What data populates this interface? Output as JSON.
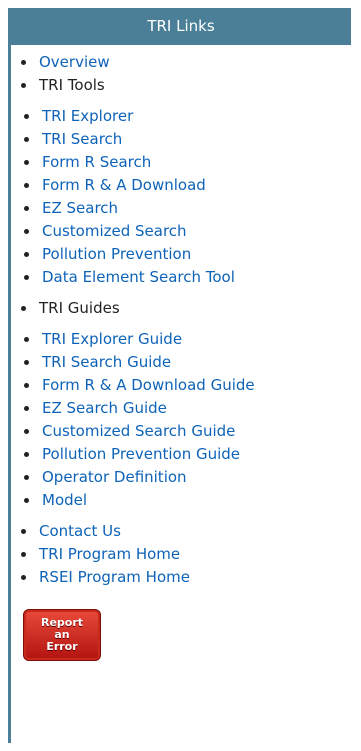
{
  "header": {
    "title": "TRI Links"
  },
  "links": {
    "overview": "Overview",
    "tri_tools": {
      "label": "TRI Tools",
      "items": [
        "TRI Explorer",
        "TRI Search",
        "Form R Search",
        "Form R & A Download",
        "EZ Search",
        "Customized Search",
        "Pollution Prevention",
        "Data Element Search Tool"
      ]
    },
    "tri_guides": {
      "label": "TRI Guides",
      "items": [
        "TRI Explorer Guide",
        "TRI Search Guide",
        "Form R & A Download Guide",
        "EZ Search Guide",
        "Customized Search Guide",
        "Pollution Prevention Guide",
        "Operator Definition",
        "Model"
      ]
    },
    "contact": "Contact Us",
    "tri_home": "TRI Program Home",
    "rsei_home": "RSEI Program Home"
  },
  "report_button": {
    "line1": "Report",
    "line2": "an",
    "line3": "Error",
    "color": "#c8221a"
  },
  "colors": {
    "header_bg": "#4a7f97",
    "link": "#0e63b8"
  }
}
